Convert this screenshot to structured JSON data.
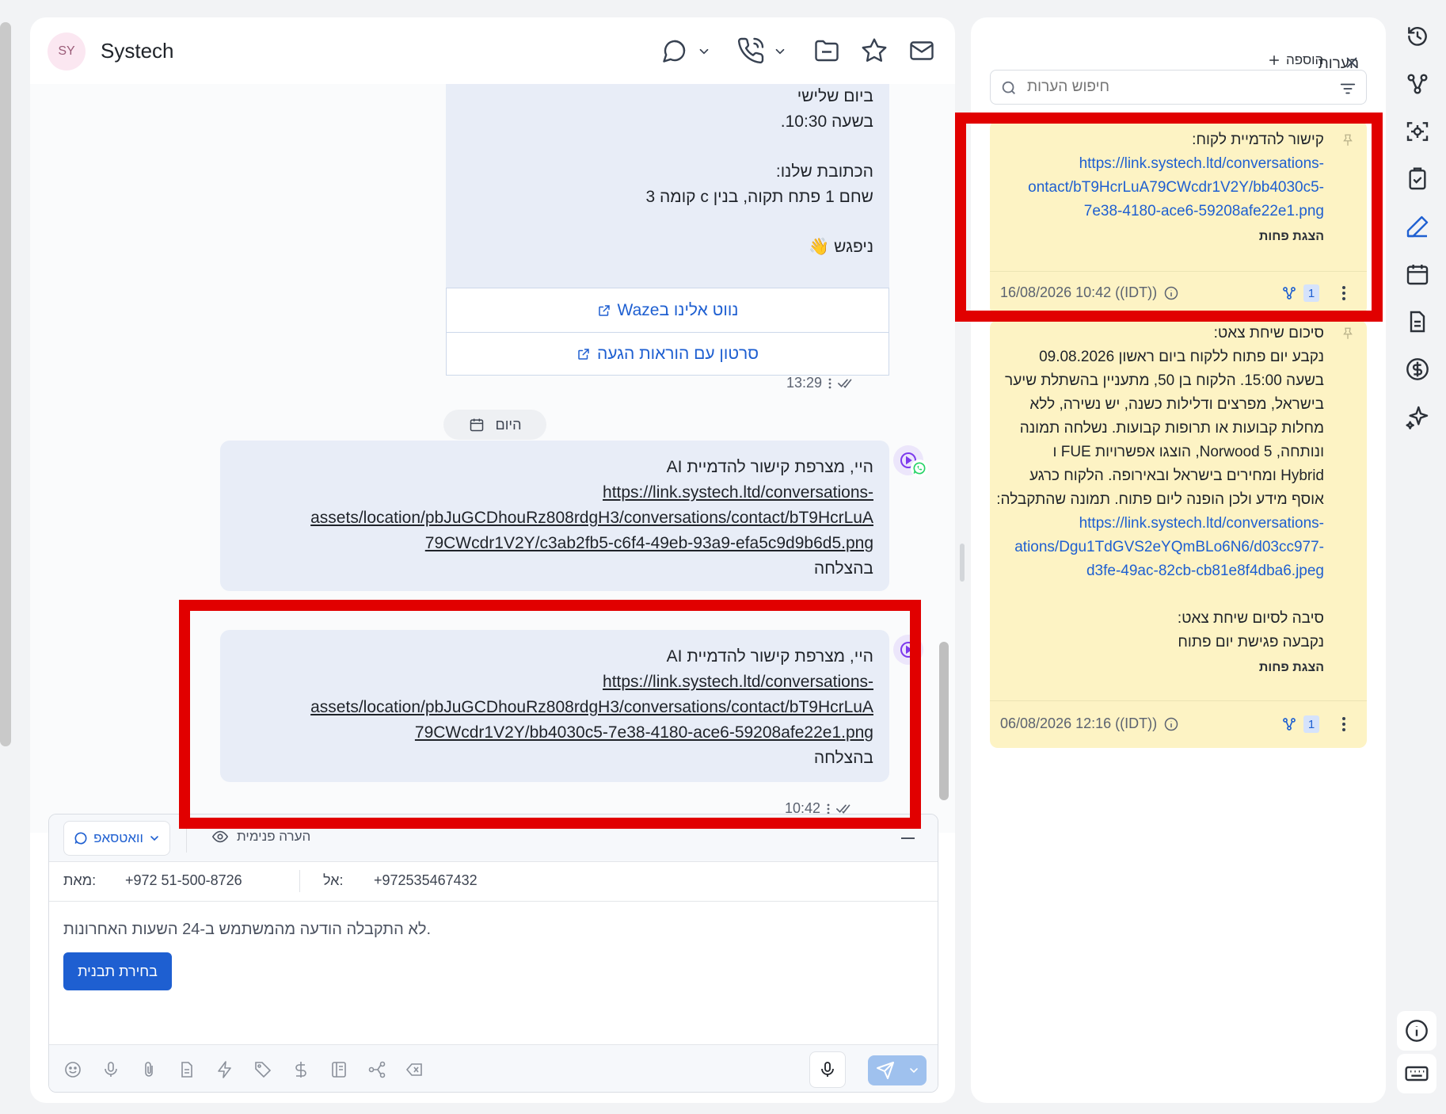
{
  "header": {
    "avatar_initials": "SY",
    "contact_name": "Systech",
    "icons": [
      "chat-icon",
      "phone-icon",
      "folder-icon",
      "star-icon",
      "mail-icon"
    ]
  },
  "messages": {
    "top_bubble_lines": [
      "ביום שלישי",
      "בשעה 10:30.",
      "",
      "הכתובת שלנו:",
      "שחם 1 פתח תקוה, בנין c קומה 3",
      "",
      "ניפגש 👋"
    ],
    "buttons": [
      "נווט אלינו בWaze",
      "סרטון עם הוראות הגעה"
    ],
    "top_time": "13:29",
    "date_chip": "היום",
    "ai_msg_1": {
      "line1": "היי, מצרפת קישור להדמיית AI",
      "link_lines": [
        "https://link.systech.ltd/conversations-",
        "assets/location/pbJuGCDhouRz808rdgH3/conversations/contact/bT9HcrLuA",
        "79CWcdr1V2Y/c3ab2fb5-c6f4-49eb-93a9-efa5c9d9b6d5.png"
      ],
      "status": "בהצלחה"
    },
    "ai_msg_2": {
      "line1": "היי, מצרפת קישור להדמיית AI",
      "link_lines": [
        "https://link.systech.ltd/conversations-",
        "assets/location/pbJuGCDhouRz808rdgH3/conversations/contact/bT9HcrLuA",
        "79CWcdr1V2Y/bb4030c5-7e38-4180-ace6-59208afe22e1.png"
      ],
      "status": "בהצלחה",
      "time": "10:42"
    }
  },
  "composer": {
    "channel": "וואטסאפ",
    "internal_note": "הערה פנימית",
    "from_label": "מאת:",
    "from_number": "+972 51-500-8726",
    "to_label": "אל:",
    "to_number": "+972535467432",
    "notice": "לא התקבלה הודעה מהמשתמש ב-24 השעות האחרונות.",
    "template_button": "בחירת תבנית"
  },
  "notes": {
    "title": "הערות",
    "add_label": "הוספה",
    "search_placeholder": "חיפוש הערות",
    "items": [
      {
        "heading": "קישור להדמיית לקוח:",
        "link_lines": [
          "https://link.systech.ltd/conversations-",
          "ontact/bT9HcrLuA79CWcdr1V2Y/bb4030c5-",
          "7e38-4180-ace6-59208afe22e1.png"
        ],
        "show_less": "הצגת פחות",
        "date": "16/08/2026 10:42 ((IDT))",
        "count": "1"
      },
      {
        "heading": "סיכום שיחת צאט:",
        "body_lines": [
          "נקבע יום פתוח ללקוח ביום ראשון 09.08.2026",
          "בשעה 15:00. הלקוח בן 50, מתעניין בהשתלת שיער",
          "בישראל, מפרצים ודלילות כשנה, יש נשירה, ללא",
          "מחלות קבועות או תרופות קבועות. נשלחה תמונה",
          "ונותחה, Norwood 5, הוצגו אפשרויות FUE ו",
          "Hybrid ומחירים בישראל ובאירופה. הלקוח כרגע",
          "אוסף מידע ולכן הופנה ליום פתוח. תמונה שהתקבלה:"
        ],
        "link_lines": [
          "https://link.systech.ltd/conversations-",
          "ations/Dgu1TdGVS2eYQmBLo6N6/d03cc977-",
          "d3fe-49ac-82cb-cb81e8f4dba6.jpeg"
        ],
        "reason_label": "סיבה לסיום שיחת צאט:",
        "reason": "נקבעה פגישת יום פתוח",
        "show_less": "הצגת פחות",
        "date": "06/08/2026 12:16 ((IDT))",
        "count": "1"
      }
    ]
  },
  "rail": [
    "history-icon",
    "workflow-icon",
    "scan-icon",
    "clipboard-check-icon",
    "pen-icon",
    "calendar-icon",
    "document-icon",
    "dollar-icon",
    "sparkles-icon",
    "info-icon",
    "keyboard-icon"
  ],
  "colors": {
    "accent": "#1e5fd1",
    "highlight_box": "#e10000",
    "note_bg": "#fdf3c4",
    "bubble_bg": "#e8edf7"
  }
}
